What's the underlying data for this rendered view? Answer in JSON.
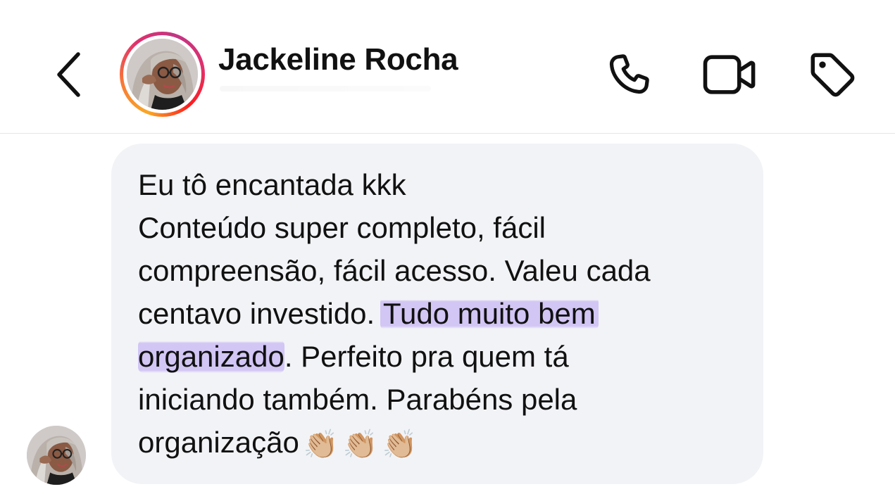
{
  "header": {
    "back_icon": "chevron-left-icon",
    "contact_name": "Jackeline Rocha",
    "call_icon": "phone-icon",
    "video_icon": "video-camera-icon",
    "tag_icon": "tag-icon",
    "story_ring_colors": [
      "#f9a825",
      "#f77737",
      "#e1306c",
      "#c13584"
    ]
  },
  "message": {
    "lines": [
      "Eu tô encantada kkk",
      "Conteúdo super completo, fácil",
      "compreensão, fácil acesso. Valeu cada",
      "centavo investido. ",
      "Tudo muito bem",
      "organizado",
      ". Perfeito pra quem tá",
      "iniciando também. Parabéns pela",
      "organização"
    ],
    "emojis": [
      "👏🏼",
      "👏🏼",
      "👏🏼"
    ],
    "bubble_color": "#f2f3f6",
    "highlight_color": "#cdbef5"
  }
}
